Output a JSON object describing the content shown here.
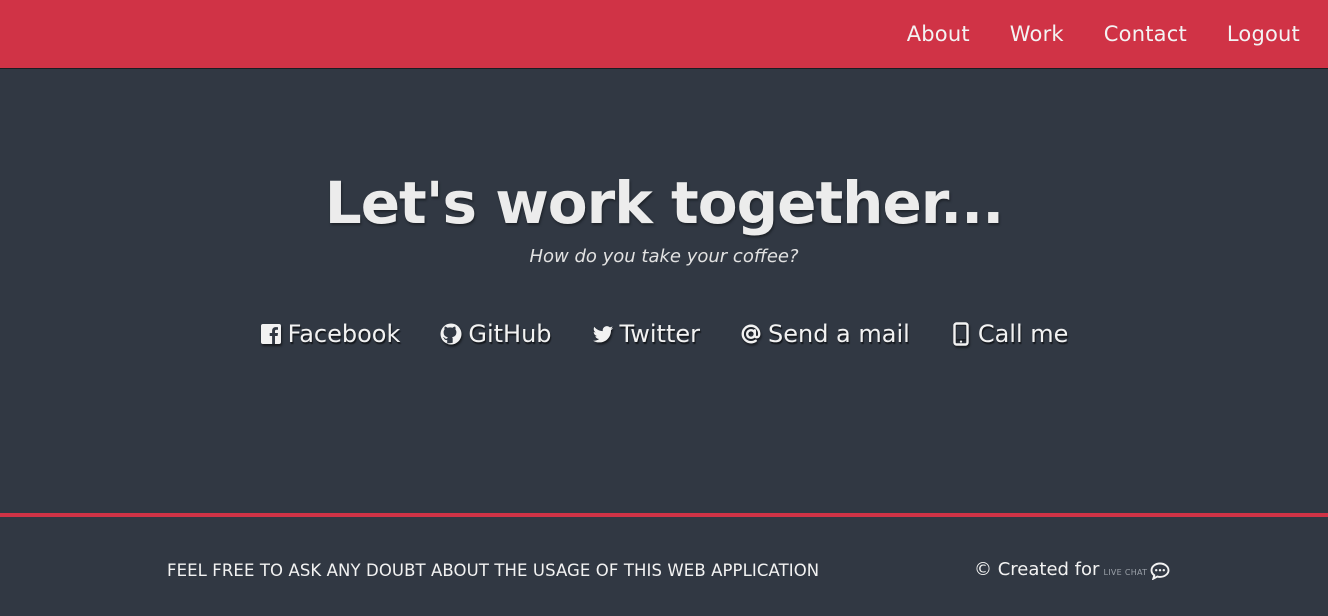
{
  "nav": {
    "items": [
      {
        "label": "About"
      },
      {
        "label": "Work"
      },
      {
        "label": "Contact"
      },
      {
        "label": "Logout"
      }
    ]
  },
  "hero": {
    "title": "Let's work together...",
    "subtitle": "How do you take your coffee?"
  },
  "social": {
    "links": [
      {
        "label": "Facebook",
        "icon": "facebook-icon"
      },
      {
        "label": "GitHub",
        "icon": "github-icon"
      },
      {
        "label": "Twitter",
        "icon": "twitter-icon"
      },
      {
        "label": "Send a mail",
        "icon": "at-icon"
      },
      {
        "label": "Call me",
        "icon": "phone-icon"
      }
    ]
  },
  "footer": {
    "left_text": "FEEL FREE TO ASK ANY DOUBT ABOUT THE USAGE OF THIS WEB APPLICATION",
    "created_text": "© Created for",
    "brand": "LIVE CHAT",
    "brand_icon": "chat-bubble-icon"
  },
  "colors": {
    "accent": "#d03346",
    "background": "#313843",
    "text": "#f2f2f2"
  }
}
